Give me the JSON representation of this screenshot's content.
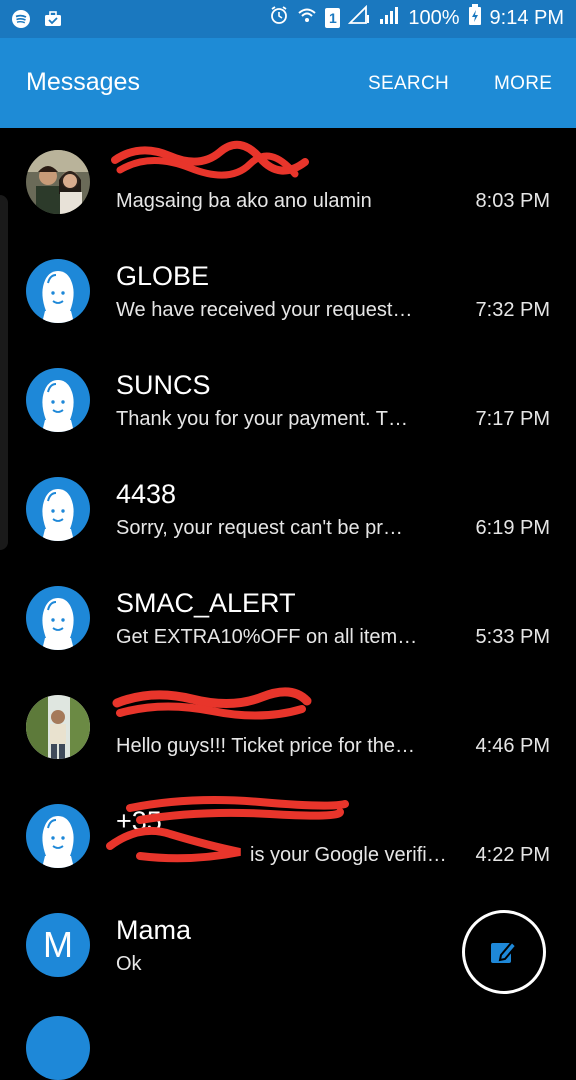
{
  "status_bar": {
    "battery_text": "100%",
    "time": "9:14 PM",
    "sim_badge": "1",
    "icons": [
      "spotify-icon",
      "briefcase-icon",
      "alarm-icon",
      "wifi-icon",
      "sim-icon",
      "signal-icon",
      "battery-charging-icon"
    ]
  },
  "app_bar": {
    "title": "Messages",
    "search_label": "SEARCH",
    "more_label": "MORE"
  },
  "conversations": [
    {
      "name": "",
      "preview": "Magsaing ba ako ano ulamin",
      "time": "8:03 PM",
      "avatar": "photo"
    },
    {
      "name": "GLOBE",
      "preview": "We have received your request…",
      "time": "7:32 PM",
      "avatar": "default-face"
    },
    {
      "name": "SUNCS",
      "preview": "Thank you for your payment. T…",
      "time": "7:17 PM",
      "avatar": "default-face"
    },
    {
      "name": "4438",
      "preview": "Sorry, your request can't be pr…",
      "time": "6:19 PM",
      "avatar": "default-face"
    },
    {
      "name": "SMAC_ALERT",
      "preview": "Get EXTRA10%OFF on all item…",
      "time": "5:33 PM",
      "avatar": "default-face"
    },
    {
      "name": "",
      "preview": "Hello guys!!! Ticket price for the…",
      "time": "4:46 PM",
      "avatar": "photo"
    },
    {
      "name": "+35",
      "preview": "is your Google verific…",
      "time": "4:22 PM",
      "avatar": "default-face"
    },
    {
      "name": "Mama",
      "preview": "Ok",
      "time": "",
      "avatar": "letter",
      "letter": "M"
    }
  ],
  "colors": {
    "accent": "#1e8bd6",
    "status_bar": "#1a78bf",
    "avatar_bg": "#1e88d8",
    "redaction": "#e8352b"
  },
  "fab": {
    "icon": "compose-icon"
  }
}
